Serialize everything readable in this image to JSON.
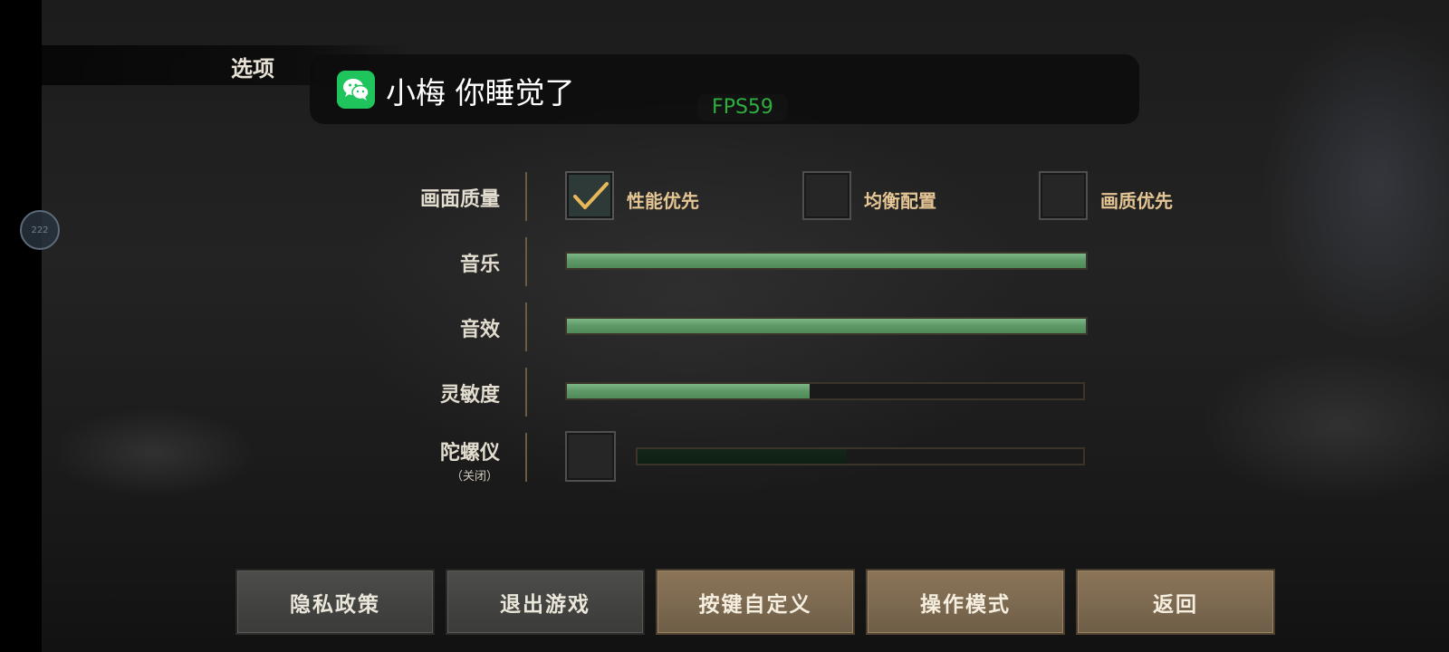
{
  "page": {
    "title": "选项",
    "float_ball": "222"
  },
  "notification": {
    "app_icon": "wechat-icon",
    "text": "小梅 你睡觉了"
  },
  "fps": "FPS59",
  "settings": {
    "quality": {
      "label": "画面质量",
      "options": [
        {
          "label": "性能优先",
          "checked": true
        },
        {
          "label": "均衡配置",
          "checked": false
        },
        {
          "label": "画质优先",
          "checked": false
        }
      ]
    },
    "music": {
      "label": "音乐",
      "value": 1.0
    },
    "sfx": {
      "label": "音效",
      "value": 1.0
    },
    "sensitivity": {
      "label": "灵敏度",
      "value": 0.47
    },
    "gyroscope": {
      "label": "陀螺仪",
      "status": "（关闭）",
      "checked": false,
      "value": 0.47
    }
  },
  "buttons": {
    "privacy": "隐私政策",
    "exit": "退出游戏",
    "keymap": "按键自定义",
    "control_mode": "操作模式",
    "back": "返回"
  },
  "colors": {
    "slider_fill": "#5f9a68",
    "option_text": "#e4c594",
    "fps_text": "#2fae3e",
    "wechat_green": "#1fc45c"
  }
}
